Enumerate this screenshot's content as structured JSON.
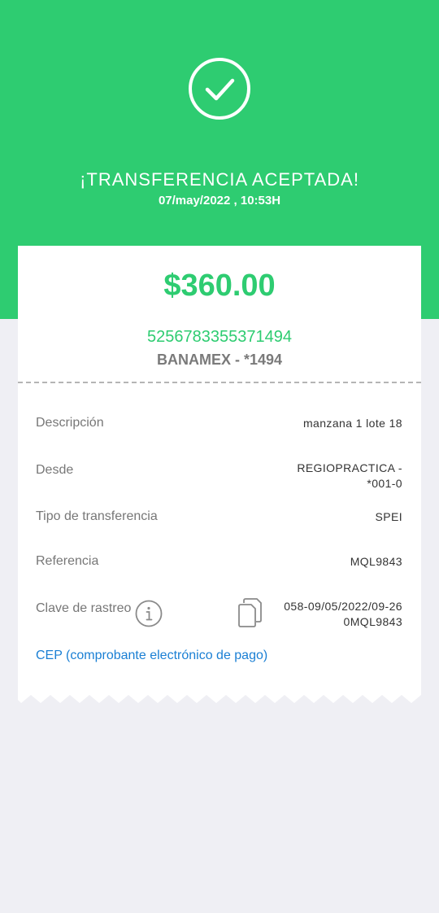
{
  "header": {
    "title": "¡TRANSFERENCIA ACEPTADA!",
    "datetime": "07/may/2022 , 10:53H",
    "status_icon": "check-circle-icon",
    "color": "#2ecc71"
  },
  "summary": {
    "amount": "$360.00",
    "account_number": "5256783355371494",
    "bank": "BANAMEX - *1494"
  },
  "details": {
    "descripcion": {
      "label": "Descripción",
      "value": "manzana 1 lote 18"
    },
    "desde": {
      "label": "Desde",
      "value_line1": "REGIOPRACTICA -",
      "value_line2": "*001-0"
    },
    "tipo": {
      "label": "Tipo de transferencia",
      "value": "SPEI"
    },
    "referencia": {
      "label": "Referencia",
      "value": "MQL9843"
    },
    "clave": {
      "label": "Clave de rastreo",
      "value_line1": "058-09/05/2022/09-26",
      "value_line2": "0MQL9843",
      "info_icon": "info-icon",
      "copy_icon": "copy-icon"
    }
  },
  "cep_link": "CEP (comprobante electrónico de pago)",
  "colors": {
    "accent": "#2ecc71",
    "link": "#1a7fd4",
    "background": "#efeff4"
  }
}
